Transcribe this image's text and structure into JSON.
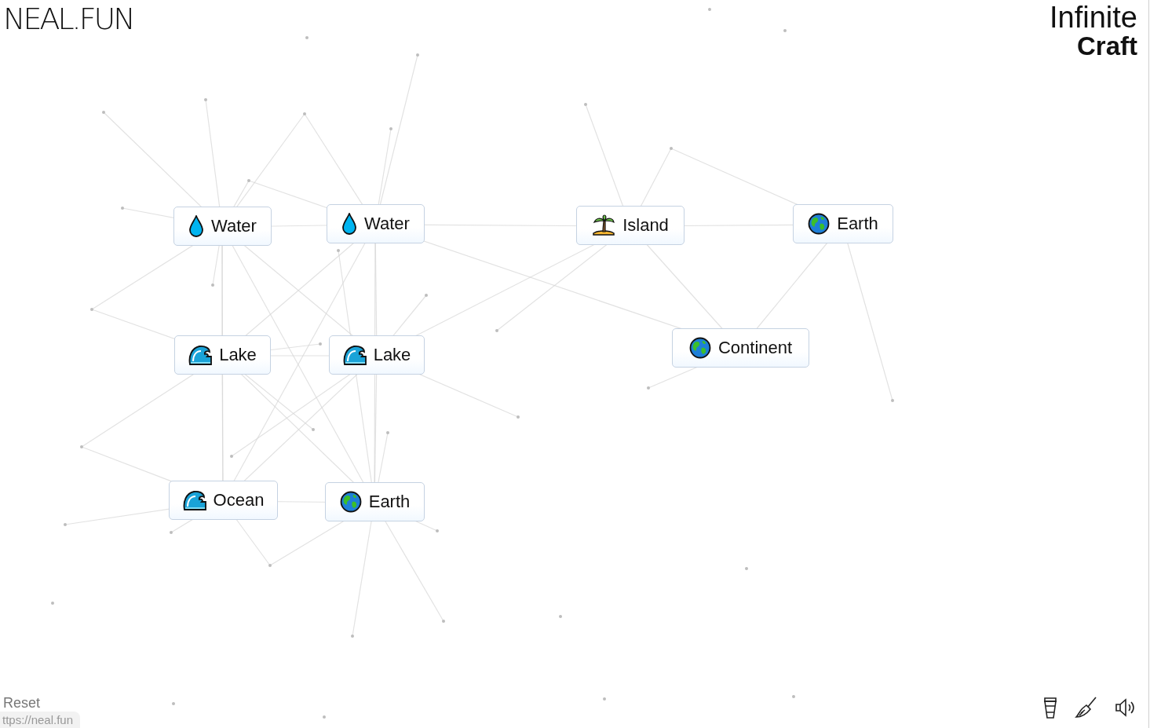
{
  "logo": "NEAL.FUN",
  "title": {
    "line_1": "Infinite",
    "line_2": "Craft"
  },
  "elements": [
    {
      "name": "Water",
      "kind": "drop"
    },
    {
      "name": "Water",
      "kind": "drop"
    },
    {
      "name": "Island",
      "kind": "island"
    },
    {
      "name": "Earth",
      "kind": "globe"
    },
    {
      "name": "Lake",
      "kind": "wave"
    },
    {
      "name": "Lake",
      "kind": "wave"
    },
    {
      "name": "Continent",
      "kind": "globe"
    },
    {
      "name": "Ocean",
      "kind": "wave"
    },
    {
      "name": "Earth",
      "kind": "globe"
    }
  ],
  "reset": "Reset",
  "status_url": "ttps://neal.fun"
}
